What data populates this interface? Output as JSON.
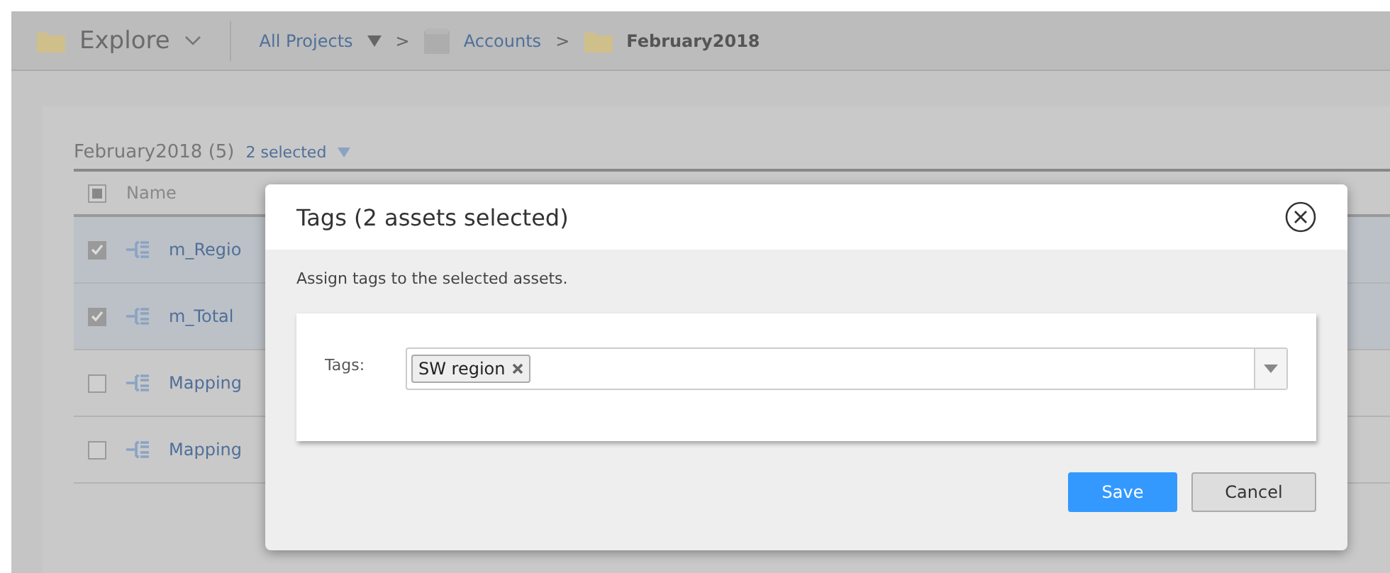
{
  "topbar": {
    "title": "Explore",
    "breadcrumbs": [
      {
        "kind": "dropdown",
        "label": "All Projects"
      },
      {
        "kind": "separator",
        "label": ">"
      },
      {
        "kind": "project",
        "label": "Accounts"
      },
      {
        "kind": "separator",
        "label": ">"
      },
      {
        "kind": "current",
        "label": "February2018"
      }
    ]
  },
  "card": {
    "title": "February2018 (5)",
    "selection": "2 selected"
  },
  "table": {
    "header_partial": true,
    "columns": [
      "Name"
    ],
    "rows": [
      {
        "name": "m_Regio",
        "checked": true,
        "selected": true
      },
      {
        "name": "m_Total",
        "checked": true,
        "selected": true
      },
      {
        "name": "Mapping",
        "checked": false,
        "selected": false
      },
      {
        "name": "Mapping",
        "checked": false,
        "selected": false
      }
    ]
  },
  "dialog": {
    "title": "Tags (2 assets selected)",
    "description": "Assign tags to the selected assets.",
    "field_label": "Tags:",
    "tags": [
      "SW region"
    ],
    "buttons": [
      {
        "kind": "primary",
        "label": "Save"
      },
      {
        "kind": "secondary",
        "label": "Cancel"
      }
    ]
  }
}
